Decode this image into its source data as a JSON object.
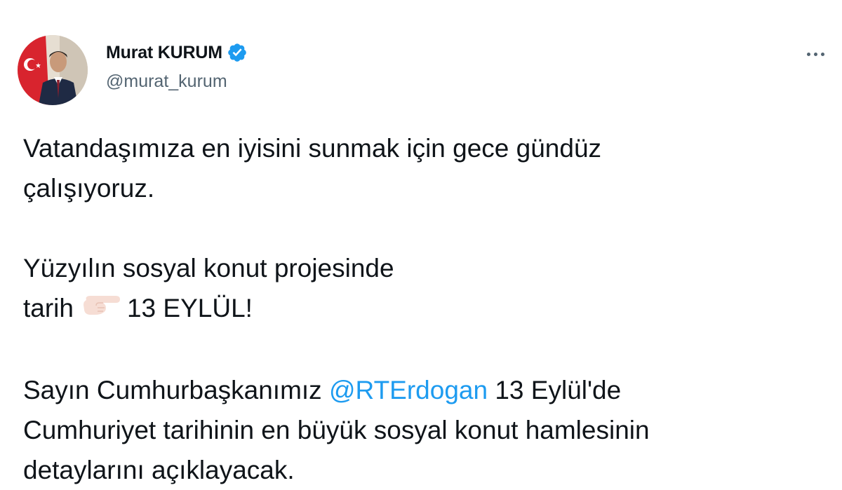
{
  "author": {
    "display_name": "Murat KURUM",
    "handle": "@murat_kurum",
    "verified": true,
    "avatar_icon": "profile-photo"
  },
  "menu": {
    "icon": "more-horizontal-icon"
  },
  "tweet": {
    "line1": "Vatandaşımıza en iyisini sunmak için gece gündüz",
    "line2": "çalışıyoruz.",
    "line3": "Yüzyılın sosyal konut projesinde",
    "line4_start": "tarih",
    "line4_emoji": "pointing-right-hand-icon",
    "line4_end": "13 EYLÜL!",
    "line5_start": "Sayın Cumhurbaşkanımız",
    "mention": "@RTErdogan",
    "line5_end": "13 Eylül'de",
    "line6": "Cumhuriyet tarihinin en büyük sosyal konut hamlesinin",
    "line7": "detaylarını açıklayacak."
  },
  "colors": {
    "text": "#0f1419",
    "secondary": "#536471",
    "accent": "#1d9bf0"
  }
}
